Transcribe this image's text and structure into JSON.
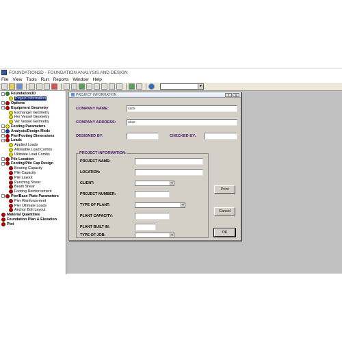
{
  "window": {
    "title": "FOUNDATION3D - FOUNDATION ANALYSIS AND DESIGN"
  },
  "menu": [
    "File",
    "View",
    "Tools",
    "Run",
    "Reports",
    "Window",
    "Help"
  ],
  "tree": [
    {
      "label": "Foundation3D",
      "level": 0,
      "status": "green",
      "bold": true,
      "expander": "-"
    },
    {
      "label": "Project Information",
      "level": 1,
      "status": "yes",
      "selected": true
    },
    {
      "label": "Options",
      "level": 0,
      "status": "no",
      "bold": true,
      "expander": "-"
    },
    {
      "label": "Equipment Geometry",
      "level": 0,
      "status": "no",
      "bold": true,
      "expander": "-"
    },
    {
      "label": "Exchanger Geometry",
      "level": 1,
      "status": "yes"
    },
    {
      "label": "Hor Vessel Geometry",
      "level": 1,
      "status": "yes"
    },
    {
      "label": "Ver Vessel Geometry",
      "level": 1,
      "status": "yes"
    },
    {
      "label": "Footing Parameters",
      "level": 0,
      "status": "yes",
      "bold": true,
      "expander": "-"
    },
    {
      "label": "Analysis/Design Mode",
      "level": 0,
      "status": "blue",
      "bold": true,
      "expander": "-"
    },
    {
      "label": "Pier/Footing Dimensions",
      "level": 0,
      "status": "no",
      "bold": true,
      "expander": "-"
    },
    {
      "label": "Loads",
      "level": 0,
      "status": "no",
      "bold": true,
      "expander": "-"
    },
    {
      "label": "Applied Loads",
      "level": 1,
      "status": "yes"
    },
    {
      "label": "Allowable Load Combs",
      "level": 1,
      "status": "yes"
    },
    {
      "label": "Ultimate Load Combs",
      "level": 1,
      "status": "yes"
    },
    {
      "label": "Pile Location",
      "level": 0,
      "status": "no",
      "bold": true,
      "expander": "-"
    },
    {
      "label": "Footing/Pile Cap Design",
      "level": 0,
      "status": "no",
      "bold": true,
      "expander": "-"
    },
    {
      "label": "Bearing Capacity",
      "level": 1,
      "status": "no"
    },
    {
      "label": "Pile Capacity",
      "level": 1,
      "status": "no"
    },
    {
      "label": "Pile Layout",
      "level": 1,
      "status": "no"
    },
    {
      "label": "Punching Shear",
      "level": 1,
      "status": "no"
    },
    {
      "label": "Beam Shear",
      "level": 1,
      "status": "no"
    },
    {
      "label": "Footing Reinforcement",
      "level": 1,
      "status": "no"
    },
    {
      "label": "Pier/Base Plate Parameters",
      "level": 0,
      "status": "no",
      "bold": true,
      "expander": "-"
    },
    {
      "label": "Pier Reinforcement",
      "level": 1,
      "status": "no"
    },
    {
      "label": "Pier Ultimate Loads",
      "level": 1,
      "status": "no"
    },
    {
      "label": "Anchor Bolt Layout",
      "level": 1,
      "status": "no"
    },
    {
      "label": "Material Quantities",
      "level": 0,
      "status": "no",
      "bold": true
    },
    {
      "label": "Foundation Plan & Elevation",
      "level": 0,
      "status": "no",
      "bold": true
    },
    {
      "label": "Plot",
      "level": 0,
      "status": "no",
      "bold": true
    }
  ],
  "dialog": {
    "title": "PROJECT INFORMATION",
    "help_label": "?",
    "close_label": "X",
    "company_name_label": "COMPANY  NAME:",
    "company_name_value": "sads",
    "company_address_label": "COMPANY  ADDRESS:",
    "company_address_value": "asas",
    "designed_by_label": "DESIGNED BY:",
    "designed_by_value": "",
    "checked_by_label": "CHECKED BY:",
    "checked_by_value": "",
    "group_title": "PROJECT INFORMATION:",
    "project_name_label": "PROJECT NAME:",
    "location_label": "LOCATION:",
    "client_label": "CLIENT:",
    "project_number_label": "PROJECT NUMBER:",
    "type_of_plant_label": "TYPE OF PLANT:",
    "plant_capacity_label": "PLANT CAPACITY:",
    "plant_built_in_label": "PLANT BUILT IN:",
    "type_of_job_label": "TYPE OF JOB:",
    "print_button": "Print",
    "cancel_button": "Cancel",
    "ok_button": "OK"
  },
  "colors": {
    "label_purple": "#4a1a6a",
    "selection": "#0a246a",
    "status_no": "#c80000",
    "status_yes": "#e8e000"
  }
}
